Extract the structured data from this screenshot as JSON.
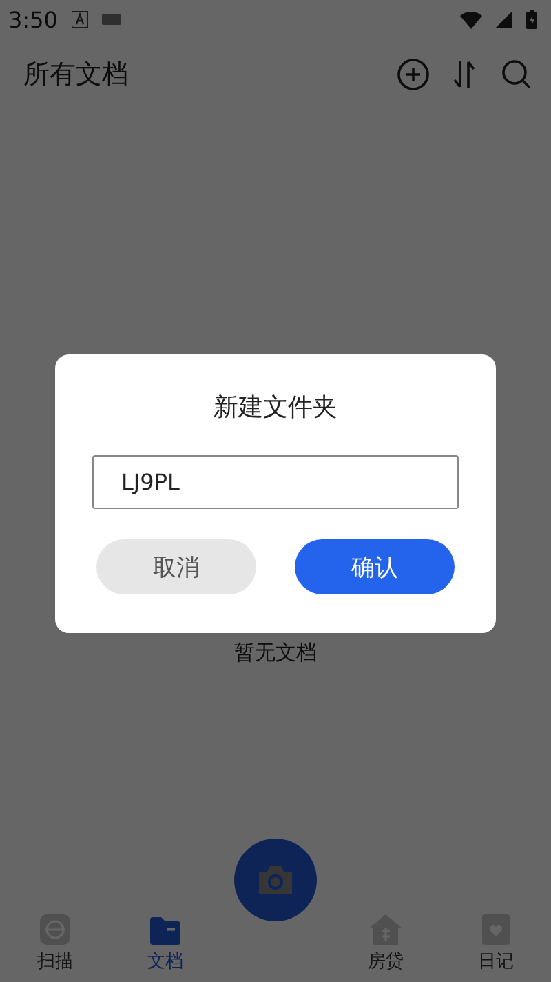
{
  "status_bar": {
    "time": "3:50"
  },
  "header": {
    "title": "所有文档"
  },
  "empty_state": {
    "text": "暂无文档"
  },
  "dialog": {
    "title": "新建文件夹",
    "input": {
      "value": "LJ9PL"
    },
    "buttons": [
      {
        "label": "取消",
        "kind": "cancel"
      },
      {
        "label": "确认",
        "kind": "confirm"
      }
    ]
  },
  "tab_bar": {
    "items": [
      {
        "label": "扫描",
        "kind": "scan",
        "selected": false
      },
      {
        "label": "文档",
        "kind": "docs",
        "selected": true
      },
      {
        "kind": "camera",
        "selected": false
      },
      {
        "label": "房贷",
        "kind": "loan",
        "selected": false
      },
      {
        "label": "日记",
        "kind": "diary",
        "selected": false
      }
    ]
  }
}
